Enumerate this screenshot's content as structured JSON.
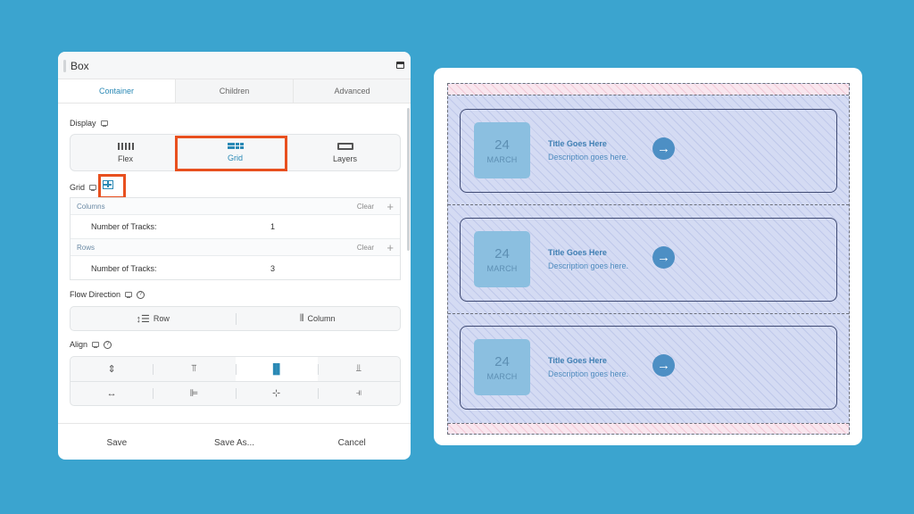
{
  "panel": {
    "title": "Box",
    "tabs": [
      "Container",
      "Children",
      "Advanced"
    ],
    "display": {
      "label": "Display",
      "options": [
        {
          "label": "Flex",
          "icon": "flex-icon"
        },
        {
          "label": "Grid",
          "icon": "grid-icon"
        },
        {
          "label": "Layers",
          "icon": "layers-icon"
        }
      ],
      "selected": "Grid"
    },
    "grid": {
      "label": "Grid",
      "columns": {
        "header": "Columns",
        "clear": "Clear",
        "track_label": "Number of Tracks:",
        "track_value": "1"
      },
      "rows": {
        "header": "Rows",
        "clear": "Clear",
        "track_label": "Number of Tracks:",
        "track_value": "3"
      }
    },
    "flow_direction": {
      "label": "Flow Direction",
      "options": [
        "Row",
        "Column"
      ]
    },
    "align": {
      "label": "Align"
    },
    "footer": {
      "save": "Save",
      "save_as": "Save As...",
      "cancel": "Cancel"
    }
  },
  "preview": {
    "cards": [
      {
        "day": "24",
        "month": "MARCH",
        "title": "Title Goes Here",
        "description": "Description goes here."
      },
      {
        "day": "24",
        "month": "MARCH",
        "title": "Title Goes Here",
        "description": "Description goes here."
      },
      {
        "day": "24",
        "month": "MARCH",
        "title": "Title Goes Here",
        "description": "Description goes here."
      }
    ]
  },
  "colors": {
    "background": "#3ba4cf",
    "accent": "#2a89b5",
    "highlight": "#e8501f"
  }
}
